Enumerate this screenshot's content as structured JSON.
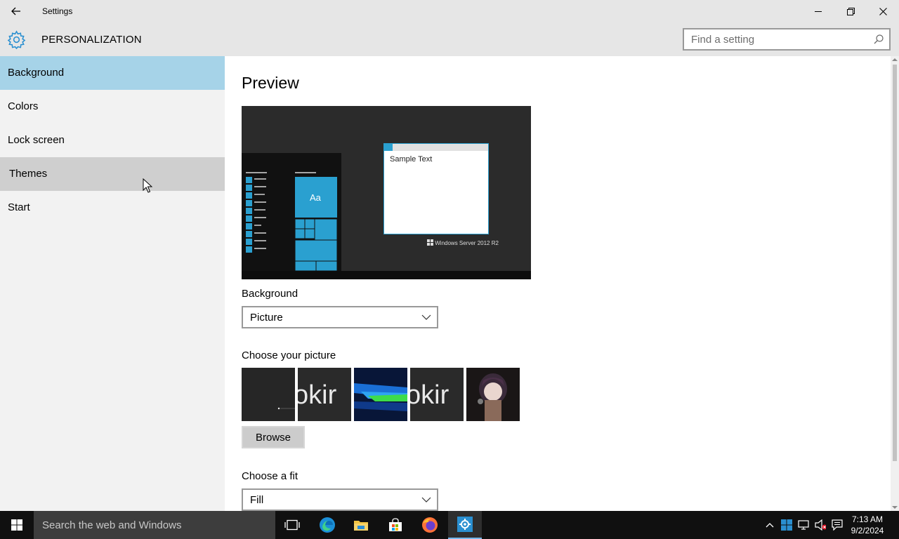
{
  "window": {
    "title": "Settings"
  },
  "header": {
    "title": "PERSONALIZATION",
    "search_placeholder": "Find a setting"
  },
  "sidebar": {
    "items": [
      {
        "label": "Background"
      },
      {
        "label": "Colors"
      },
      {
        "label": "Lock screen"
      },
      {
        "label": "Themes"
      },
      {
        "label": "Start"
      }
    ]
  },
  "main": {
    "title": "Preview",
    "preview": {
      "sample_text": "Sample Text",
      "tile_text": "Aa",
      "watermark": "Windows Server 2012 R2"
    },
    "background_label": "Background",
    "background_value": "Picture",
    "choose_picture_label": "Choose your picture",
    "thumbnail_text": "okir",
    "browse_label": "Browse",
    "fit_label": "Choose a fit",
    "fit_value": "Fill"
  },
  "taskbar": {
    "search_placeholder": "Search the web and Windows",
    "time": "7:13 AM",
    "date": "9/2/2024"
  },
  "colors": {
    "accent": "#2aa0d0",
    "selected_nav": "#a6d3e8",
    "active_taskbar": "#76b9ed"
  }
}
